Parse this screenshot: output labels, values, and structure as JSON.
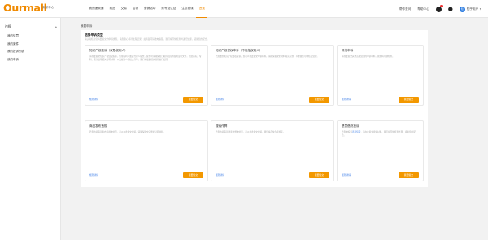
{
  "header": {
    "logo": "Ourmall",
    "logo_sub": "卖家中心",
    "nav": [
      "我的速卖通",
      "商品",
      "交易",
      "店铺",
      "营销活动",
      "账号及认证",
      "生意参谋",
      "违规"
    ],
    "active_nav_index": 7,
    "right_links": [
      "帮你查问",
      "帮助中心"
    ],
    "user_name": "知乎用户",
    "user_initial": "知"
  },
  "sidebar": {
    "title": "违规",
    "items": [
      "我的处罚",
      "我的案件",
      "我的投诉列表",
      "我的申诉"
    ]
  },
  "main": {
    "breadcrumb": "我要申诉",
    "panel_title": "选择申诉类型",
    "panel_subtitle": "请认真核对您将要提交的申诉类型，请您耐心等待处理结果，如有疑问请致电客服，我们将尽快核查并进行处理，感谢您的配合。",
    "cards": [
      {
        "title": "知识产权投诉（仅限权利人）",
        "desc": "请在此提交知识产权侵权投诉，仅限权利人或其代理人提交，提交时请确保您已取得相应的权利证明文件，包括商标、专利、著作权等相关证明材料，以及权利人授权文件等，我们将根据相关规则进行处理。",
        "link": "规则详情",
        "button": "我要提交"
      },
      {
        "title": "知识产权侵权申诉（不包括权利人）",
        "desc": "若您收到知识产权侵权投诉，您可以在此提交申诉材料，请确保提交的材料真实有效，以便我们尽快核实处理。",
        "link": "规则详情",
        "button": "我要提交"
      },
      {
        "title": "其他申诉",
        "desc": "请在此提交其他违规处罚的申诉材料，我们将尽快核查。",
        "link": "规则详情",
        "button": "我要提交"
      },
      {
        "title": "商品发布违规",
        "desc": "若您的商品因发布违规被处罚，可以在此提交申诉，请确保提交完整的证明材料。",
        "link": "规则详情",
        "button": "我要提交"
      },
      {
        "title": "搜索作弊",
        "desc": "若您的商品因搜索作弊被处罚，可以在此提交申诉，我们将尽快为您核实。",
        "link": "规则详情",
        "button": "我要提交"
      },
      {
        "title": "恶意借货投诉",
        "desc_prefix": "若您被投诉",
        "desc_link": "恶意借货",
        "desc_suffix": "，请在此提交申诉材料，我们将尽快核查处理，感谢您的配合。",
        "link": "规则详情",
        "button": "我要提交"
      }
    ]
  },
  "colors": {
    "brand": "#f08a00",
    "button": "#f39800",
    "link": "#4a86e8",
    "avatar": "#2a7be0"
  }
}
